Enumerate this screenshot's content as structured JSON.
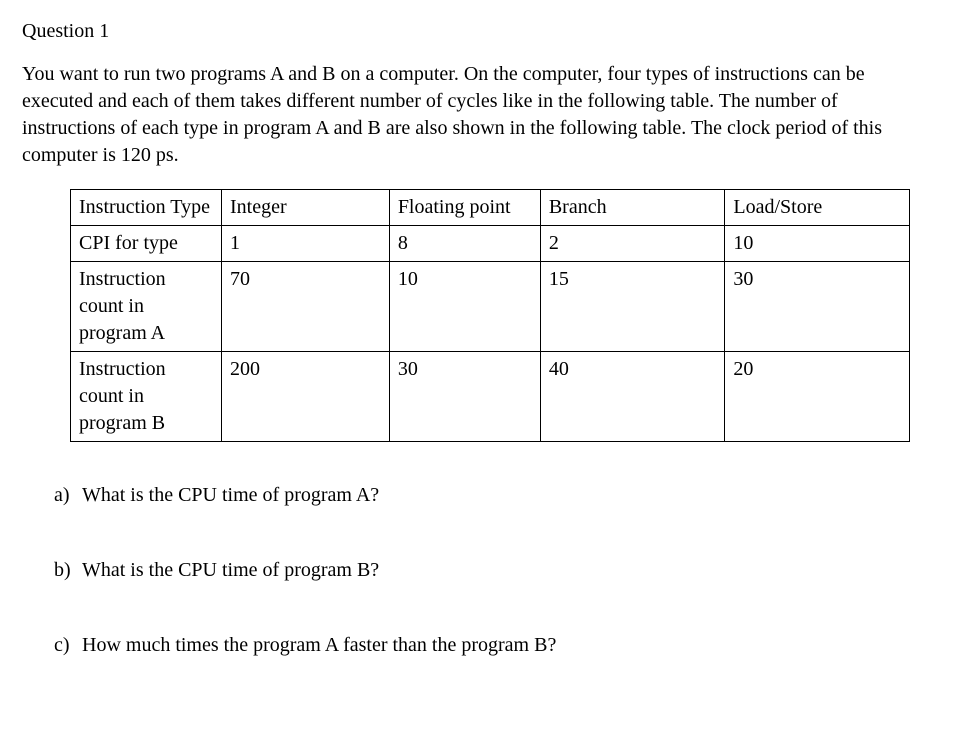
{
  "title": "Question 1",
  "intro": "You want to run two programs A and B on a computer. On the computer, four types of instructions can be executed and each of them takes different number of cycles like in the following table. The number of instructions of each type in program A and B are also shown in the following table. The clock period of this computer is 120 ps.",
  "table": {
    "header": {
      "rowLabel": "Instruction Type",
      "cols": [
        "Integer",
        "Floating point",
        "Branch",
        "Load/Store"
      ]
    },
    "rows": [
      {
        "label": "CPI for type",
        "values": [
          "1",
          "8",
          "2",
          "10"
        ]
      },
      {
        "label": "Instruction count in program A",
        "values": [
          "70",
          "10",
          "15",
          "30"
        ]
      },
      {
        "label": "Instruction count in program B",
        "values": [
          "200",
          "30",
          "40",
          "20"
        ]
      }
    ]
  },
  "questions": [
    {
      "label": "a)",
      "text": "What is the CPU time of program A?"
    },
    {
      "label": "b)",
      "text": "What is the CPU time of program B?"
    },
    {
      "label": "c)",
      "text": "How much times the program A faster than the program B?"
    }
  ]
}
